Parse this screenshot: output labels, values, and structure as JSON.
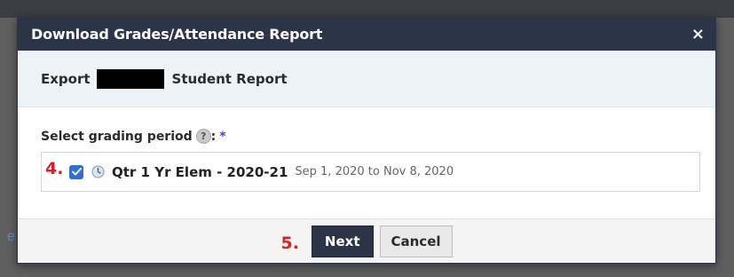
{
  "dialog": {
    "title": "Download Grades/Attendance Report",
    "close_label": "×"
  },
  "subheader": {
    "prefix": "Export",
    "suffix": "Student Report"
  },
  "form": {
    "label": "Select grading period",
    "help": "?",
    "colon": ":",
    "required": "*"
  },
  "period": {
    "checked": true,
    "name": "Qtr 1 Yr Elem - 2020-21",
    "dates": "Sep 1, 2020 to Nov 8, 2020"
  },
  "annotations": {
    "step4": "4.",
    "step5": "5."
  },
  "buttons": {
    "next": "Next",
    "cancel": "Cancel"
  },
  "colors": {
    "header_bg": "#2b3547",
    "accent": "#2f6fd6",
    "annotation": "#e02020"
  }
}
